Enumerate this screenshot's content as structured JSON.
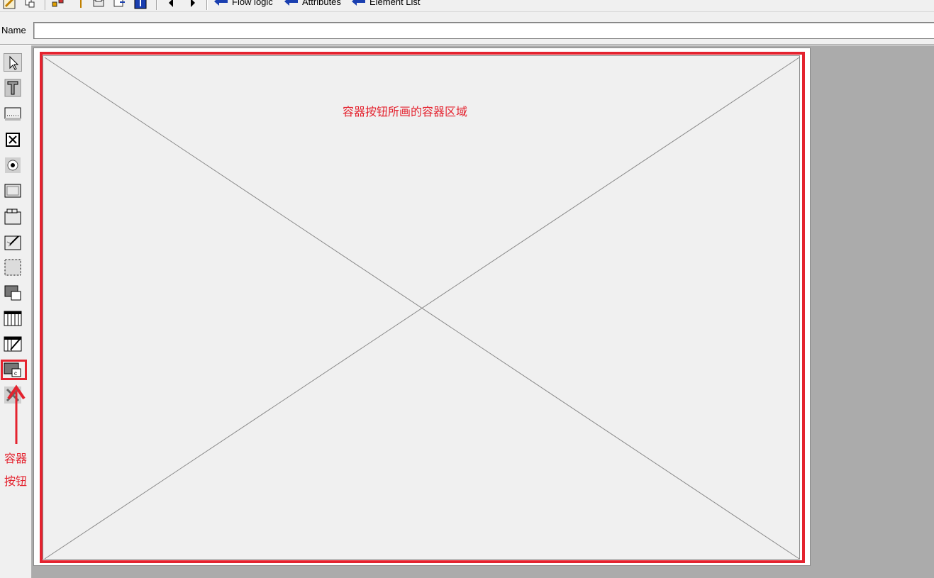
{
  "toolbar": {
    "nav_links": [
      {
        "label": "Flow logic"
      },
      {
        "label": "Attributes"
      },
      {
        "label": "Element List"
      }
    ]
  },
  "name_field": {
    "label": "Name",
    "value": ""
  },
  "palette": {
    "tools": [
      {
        "icon": "pointer-icon"
      },
      {
        "icon": "text-field-icon"
      },
      {
        "icon": "input-field-icon"
      },
      {
        "icon": "checkbox-icon"
      },
      {
        "icon": "radio-button-icon"
      },
      {
        "icon": "pushbutton-icon"
      },
      {
        "icon": "tabstrip-icon"
      },
      {
        "icon": "tabstrip-wizard-icon"
      },
      {
        "icon": "box-icon"
      },
      {
        "icon": "subscreen-icon"
      },
      {
        "icon": "table-control-icon"
      },
      {
        "icon": "table-control-wizard-icon"
      },
      {
        "icon": "custom-container-icon"
      },
      {
        "icon": "status-icon"
      }
    ]
  },
  "canvas": {
    "caption": "容器按钮所画的容器区域"
  },
  "annotation": {
    "label": "容器按钮",
    "color": "#e4232f"
  }
}
